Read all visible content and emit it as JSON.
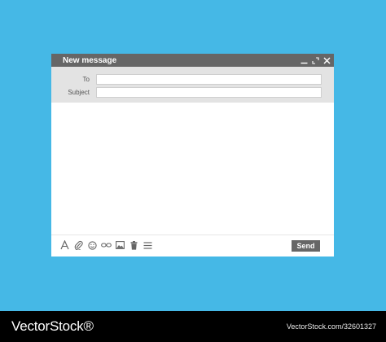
{
  "window": {
    "title": "New message"
  },
  "fields": {
    "to_label": "To",
    "to_value": "",
    "subject_label": "Subject",
    "subject_value": ""
  },
  "body": {
    "value": ""
  },
  "toolbar": {
    "icons": [
      "format-text-icon",
      "attach-icon",
      "emoji-icon",
      "link-icon",
      "image-icon",
      "delete-icon",
      "more-options-icon"
    ],
    "send_label": "Send"
  },
  "footer": {
    "brand": "VectorStock®",
    "image_id": "VectorStock.com/32601327"
  },
  "colors": {
    "background": "#45b8e6",
    "titlebar": "#666666",
    "fields_bg": "#e3e3e3",
    "send_button": "#666666"
  }
}
